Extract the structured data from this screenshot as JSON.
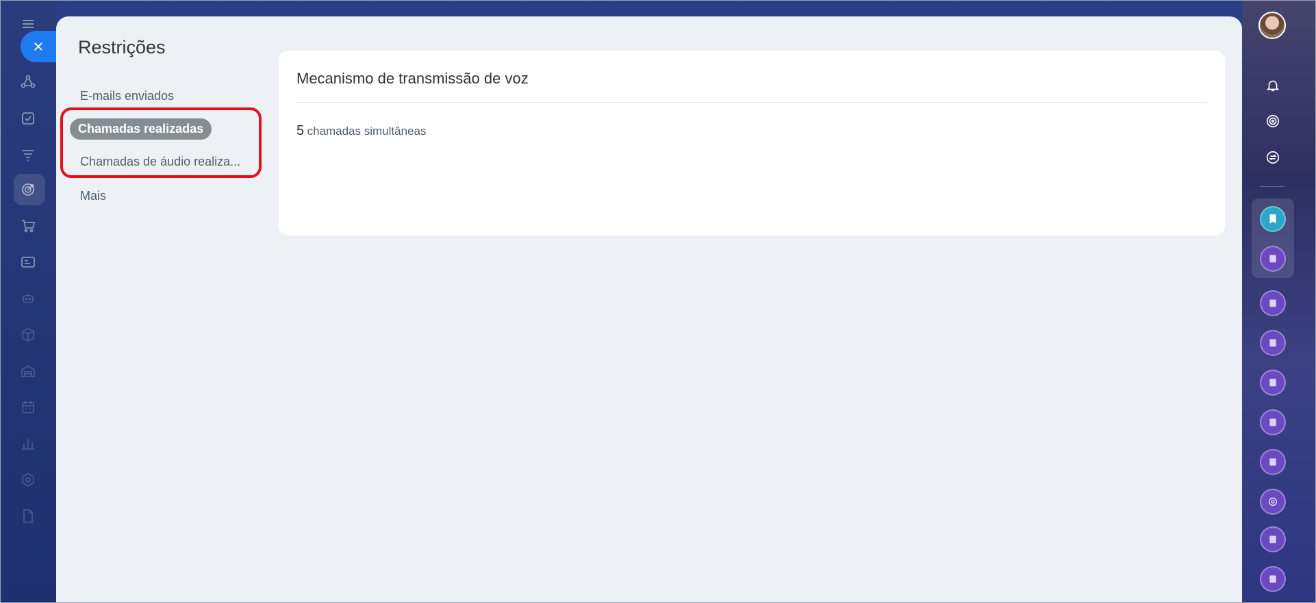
{
  "panel": {
    "title": "Restrições"
  },
  "menu": {
    "items": [
      {
        "label": "E-mails enviados"
      },
      {
        "label": "Chamadas realizadas"
      },
      {
        "label": "Chamadas de áudio realiza..."
      },
      {
        "label": "Mais"
      }
    ]
  },
  "card": {
    "title": "Mecanismo de transmissão de voz",
    "value": "5",
    "unit": "chamadas simultâneas"
  },
  "colors": {
    "accent": "#1f7bf0",
    "highlight": "#e3111a",
    "active_pill": "#868d95"
  },
  "icons": {
    "left_rail": [
      "menu-icon",
      "close-icon",
      "connections-icon",
      "tasks-icon",
      "funnel-icon",
      "target-icon",
      "cart-icon",
      "card-icon",
      "robot-icon",
      "box-icon",
      "warehouse-icon",
      "calendar-icon",
      "bar-chart-icon",
      "hexagon-icon",
      "document-icon"
    ],
    "right_rail": [
      "avatar",
      "bell-icon",
      "spiral-icon",
      "chat-swap-icon",
      "bookmark-icon",
      "app-icon"
    ]
  }
}
